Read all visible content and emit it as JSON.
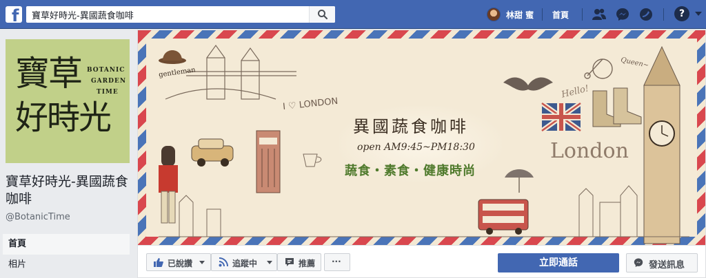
{
  "topbar": {
    "logo_letter": "f",
    "search_value": "寶草好時光-異國蔬食咖啡",
    "user_name": "林甜 蜜",
    "home_label": "首頁",
    "icons": [
      "friend-requests-icon",
      "messenger-icon",
      "notifications-icon",
      "help-icon",
      "account-menu-caret-icon"
    ],
    "help_glyph": "?"
  },
  "profile": {
    "pic_line1": "寶草",
    "pic_line2": "好時光",
    "pic_en": [
      "BOTANIC",
      "GARDEN",
      "TIME"
    ],
    "name": "寶草好時光-異國蔬食咖啡",
    "handle": "@BotanicTime"
  },
  "left_nav": {
    "items": [
      {
        "label": "首頁",
        "active": true
      },
      {
        "label": "相片",
        "active": false
      }
    ]
  },
  "cover": {
    "title": "異國蔬食咖啡",
    "hours": "open AM9:45~PM18:30",
    "subtitle": "蔬食・素食・健康時尚",
    "london": "London",
    "gentleman": "gentleman",
    "i_love_london": "I ♡ LONDON",
    "hello": "Hello!",
    "queen": "Queen~"
  },
  "actions": {
    "liked_label": "已說讚",
    "following_label": "追蹤中",
    "recommend_label": "推薦",
    "more_label": "···",
    "call_label": "立即通話",
    "message_label": "發送訊息"
  },
  "colors": {
    "brand_blue": "#4267b2",
    "page_bg": "#e9ebee",
    "profile_green": "#c1d089",
    "cover_paper": "#f3e8d3",
    "airmail_red": "#d9474e",
    "airmail_blue": "#4a74b8",
    "veg_green": "#4f7a2c"
  }
}
